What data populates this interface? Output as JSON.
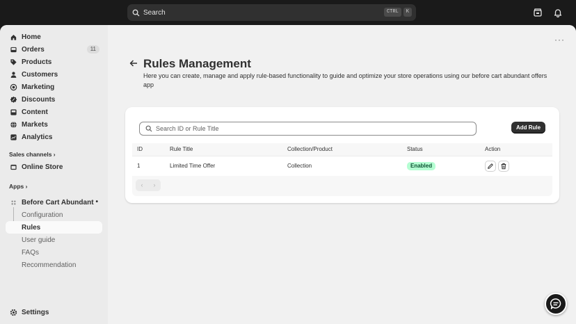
{
  "topbar": {
    "search_placeholder": "Search",
    "kbd_ctrl": "CTRL",
    "kbd_k": "K",
    "icons": [
      "store-icon",
      "bell-icon"
    ]
  },
  "sidebar": {
    "items": [
      {
        "label": "Home",
        "icon": "home-icon"
      },
      {
        "label": "Orders",
        "icon": "inbox-icon",
        "badge": "11"
      },
      {
        "label": "Products",
        "icon": "tag-icon"
      },
      {
        "label": "Customers",
        "icon": "person-icon"
      },
      {
        "label": "Marketing",
        "icon": "target-icon"
      },
      {
        "label": "Discounts",
        "icon": "discount-icon"
      },
      {
        "label": "Content",
        "icon": "content-icon"
      },
      {
        "label": "Markets",
        "icon": "globe-icon"
      },
      {
        "label": "Analytics",
        "icon": "chart-icon"
      }
    ],
    "sales_channels_label": "Sales channels",
    "online_store_label": "Online Store",
    "apps_label": "Apps",
    "app_name": "Before Cart Abundant",
    "app_sub_items": [
      "Configuration",
      "Rules",
      "User guide",
      "FAQs",
      "Recommendation"
    ],
    "settings_label": "Settings"
  },
  "page": {
    "title": "Rules Management",
    "subtitle": "Here you can create, manage and apply rule-based functionality to guide and optimize your store operations using our before cart abundant offers app"
  },
  "card": {
    "search_placeholder": "Search ID or Rule Title",
    "add_button": "Add Rule",
    "columns": [
      "ID",
      "Rule Title",
      "Collection/Product",
      "Status",
      "Action"
    ],
    "rows": [
      {
        "id": "1",
        "title": "Limited Time Offer",
        "type": "Collection",
        "status": "Enabled"
      }
    ]
  },
  "colors": {
    "status_bg": "#b4fed2",
    "status_text": "#0c5132",
    "primary_button": "#303030"
  }
}
